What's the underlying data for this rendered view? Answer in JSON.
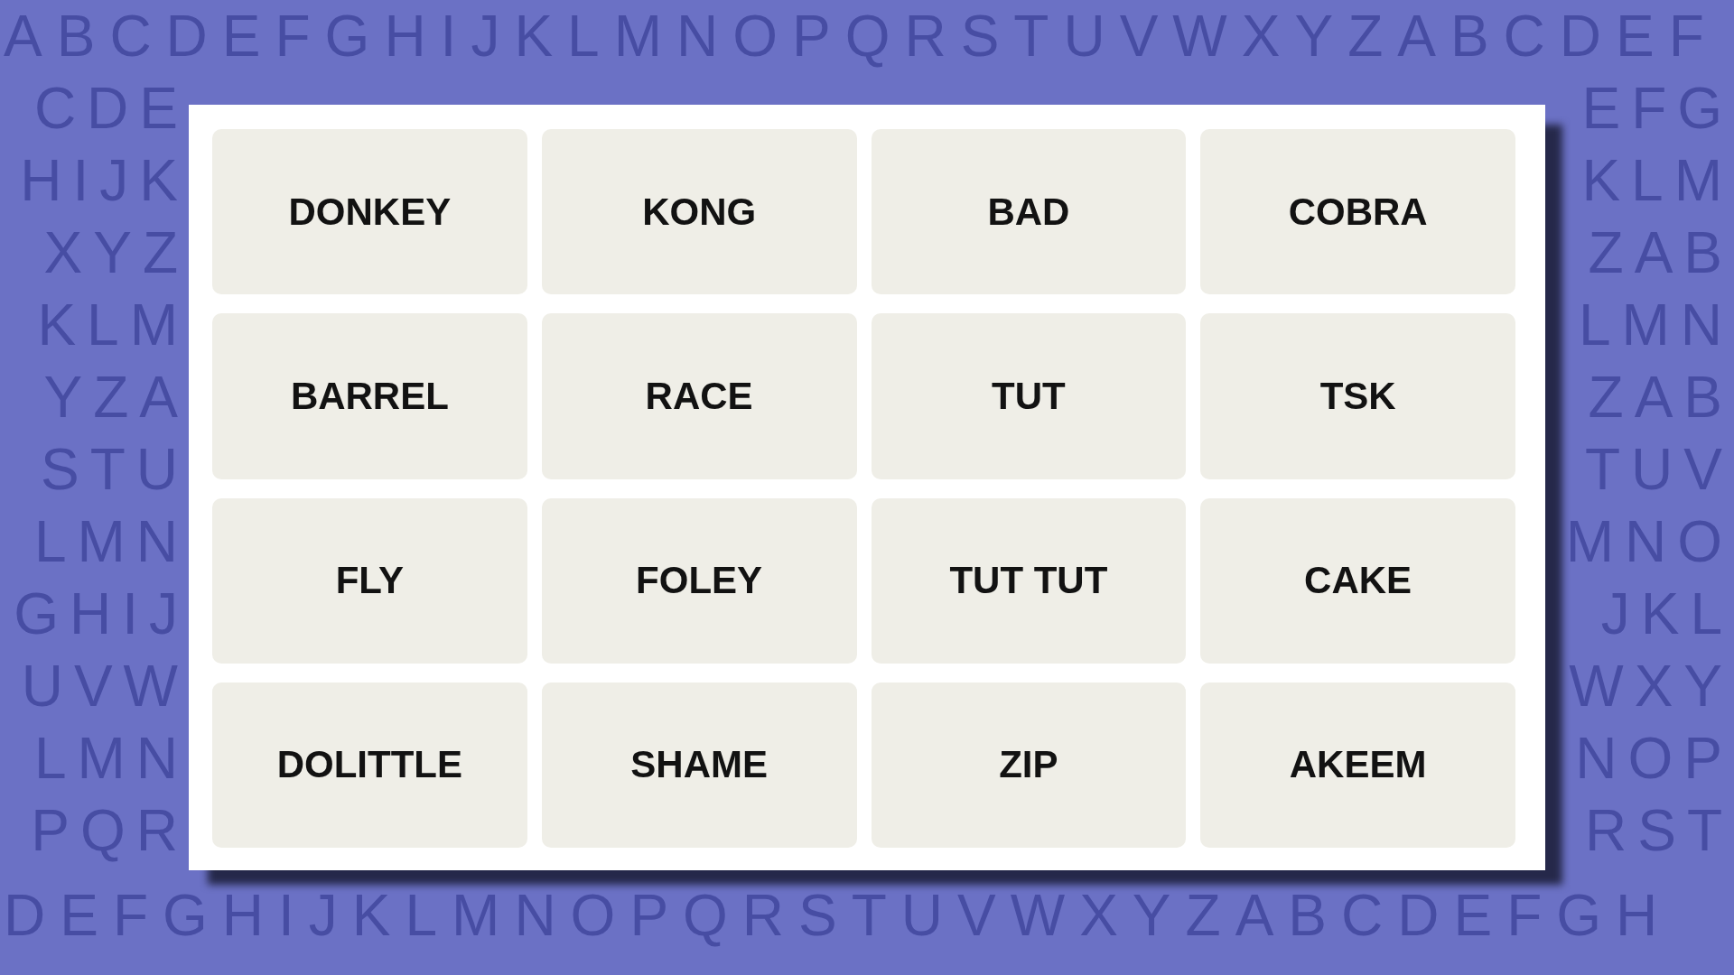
{
  "background": {
    "rows": [
      {
        "kind": "full",
        "text": "ABCDEFGHIJKLMNOPQRSTUVWXYZABCDEF"
      },
      {
        "kind": "split",
        "left": "CDE",
        "right": "EFG"
      },
      {
        "kind": "split",
        "left": "HIJK",
        "right": "KLM"
      },
      {
        "kind": "split",
        "left": "XYZ",
        "right": "ZAB"
      },
      {
        "kind": "split",
        "left": "KLM",
        "right": "LMN"
      },
      {
        "kind": "split",
        "left": "YZA",
        "right": "ZAB"
      },
      {
        "kind": "split",
        "left": "STU",
        "right": "TUV"
      },
      {
        "kind": "split",
        "left": "LMN",
        "right": "MNO"
      },
      {
        "kind": "split",
        "left": "GHIJ",
        "right": "JKL"
      },
      {
        "kind": "split",
        "left": "UVW",
        "right": "WXY"
      },
      {
        "kind": "split",
        "left": "LMN",
        "right": "NOP"
      },
      {
        "kind": "split",
        "left": "PQR",
        "right": "RST"
      },
      {
        "kind": "full",
        "text": "DEFGHIJKLMNOPQRSTUVWXYZABCDEFGH"
      }
    ]
  },
  "puzzle": {
    "tiles": [
      {
        "label": "DONKEY",
        "selected": false
      },
      {
        "label": "KONG",
        "selected": false
      },
      {
        "label": "BAD",
        "selected": false
      },
      {
        "label": "COBRA",
        "selected": false
      },
      {
        "label": "BARREL",
        "selected": false
      },
      {
        "label": "RACE",
        "selected": false
      },
      {
        "label": "TUT",
        "selected": false
      },
      {
        "label": "TSK",
        "selected": false
      },
      {
        "label": "FLY",
        "selected": false
      },
      {
        "label": "FOLEY",
        "selected": false
      },
      {
        "label": "TUT TUT",
        "selected": false
      },
      {
        "label": "CAKE",
        "selected": false
      },
      {
        "label": "DOLITTLE",
        "selected": false
      },
      {
        "label": "SHAME",
        "selected": false
      },
      {
        "label": "ZIP",
        "selected": false
      },
      {
        "label": "AKEEM",
        "selected": false
      }
    ]
  }
}
